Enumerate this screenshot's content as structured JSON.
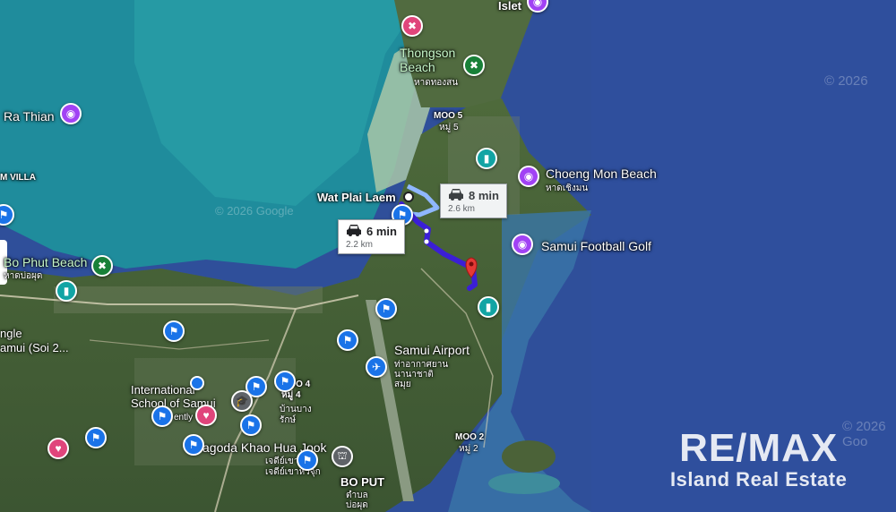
{
  "place_labels": {
    "islet": "Islet",
    "thongson_beach": "Thongson\nBeach",
    "thongson_thai": "หาดทองสน",
    "ra_thian": "Ra Thian",
    "moo5": "MOO 5",
    "moo5_thai": "หมู่ 5",
    "m_villa": "M VILLA",
    "choeng_mon": "Choeng Mon Beach",
    "choeng_mon_thai": "หาดเชิงมน",
    "wat_plai_laem": "Wat Plai Laem",
    "samui_football_golf": "Samui Football Golf",
    "bo_phut_beach": "Bo Phut Beach",
    "bo_phut_thai": "หาดบ่อผุด",
    "samui_airport": "Samui Airport",
    "samui_airport_thai": "ท่าอากาศยาน\nนานาชาติ\nสมุย",
    "intl_school": "International\nSchool of Samui",
    "intl_school_thai": "ently",
    "moo4": "MOO 4\nหมู่ 4",
    "ban_bang_rak": "บ้านบาง\nรักษ์",
    "ngle": "ngle",
    "amui_soi": "amui (Soi 2...",
    "moo2": "MOO 2",
    "moo2_thai": "หมู่ 2",
    "pagoda": "agoda Khao Hua Jook",
    "pagoda_thai": "เจดีย์เขา\nเจดีย์เขาหัวจุก",
    "bo_put": "BO PUT",
    "bo_put_thai": "ตำบล\nบ่อผุด"
  },
  "routes": [
    {
      "mode": "car",
      "duration": "6 min",
      "distance": "2.2 km",
      "selected": true
    },
    {
      "mode": "car",
      "duration": "8 min",
      "distance": "2.6 km",
      "selected": false
    }
  ],
  "watermarks": {
    "copyright1": "© 2026",
    "copyright2": "© 2026 Google",
    "copyright3": "© 2026 Goo"
  },
  "branding": {
    "logo_main": "RE/MAX",
    "logo_sub": "Island Real Estate"
  },
  "colors": {
    "route_selected": "#3b1fd6",
    "route_alt": "#8fb7ff",
    "destination_pin": "#e53935",
    "sea_deep": "#2d5aa4",
    "sea_shallow": "#2b9aa8"
  }
}
